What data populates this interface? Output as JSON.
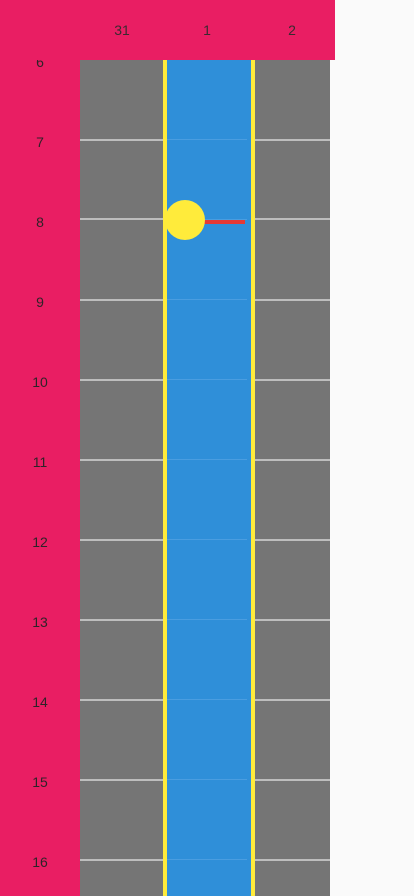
{
  "header": {
    "days": [
      "31",
      "1",
      "2"
    ]
  },
  "hours": [
    "6",
    "7",
    "8",
    "9",
    "10",
    "11",
    "12",
    "13",
    "14",
    "15",
    "16"
  ],
  "colors": {
    "accent": "#e91e63",
    "grid": "#757575",
    "today_column": "#2f8fd9",
    "today_border": "#ffeb3b",
    "now_indicator": "#ffeb3b",
    "now_line": "#e53935"
  }
}
